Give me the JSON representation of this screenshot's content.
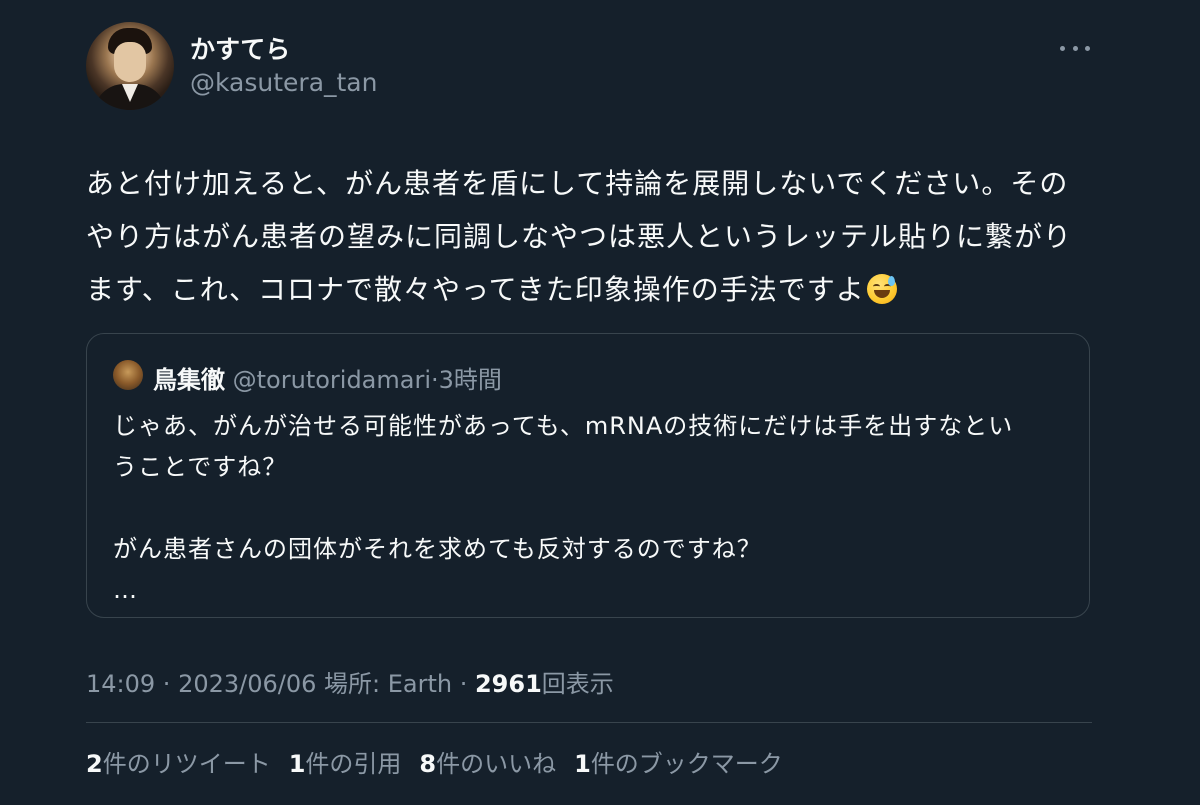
{
  "author": {
    "display_name": "かすてら",
    "handle": "@kasutera_tan"
  },
  "tweet": {
    "lines": [
      "あと付け加えると、がん患者を盾にして持論を展開しないでください。その",
      "やり方はがん患者の望みに同調しなやつは悪人というレッテル貼りに繋がり",
      "ます、これ、コロナで散々やってきた印象操作の手法ですよ"
    ],
    "emoji": "sweat-smile-emoji"
  },
  "quote": {
    "name": "鳥集徹",
    "handle": "@torutoridamari",
    "dot": "·",
    "time": "3時間",
    "lines": [
      "じゃあ、がんが治せる可能性があっても、mRNAの技術にだけは手を出すなとい",
      "うことですね？",
      "",
      "がん患者さんの団体がそれを求めても反対するのですね？",
      "…"
    ]
  },
  "meta": {
    "time": "14:09",
    "sep1": " · ",
    "date": "2023/06/06",
    "location": " 場所: Earth",
    "sep2": " · ",
    "views_count": "2961",
    "views_label": "回表示"
  },
  "stats": [
    {
      "num": "2",
      "label": "件のリツイート"
    },
    {
      "num": "1",
      "label": "件の引用"
    },
    {
      "num": "8",
      "label": "件のいいね"
    },
    {
      "num": "1",
      "label": "件のブックマーク"
    }
  ],
  "colors": {
    "background": "#15202b",
    "text": "#f7f9f9",
    "secondary": "#8b98a5",
    "border": "#38444d"
  }
}
